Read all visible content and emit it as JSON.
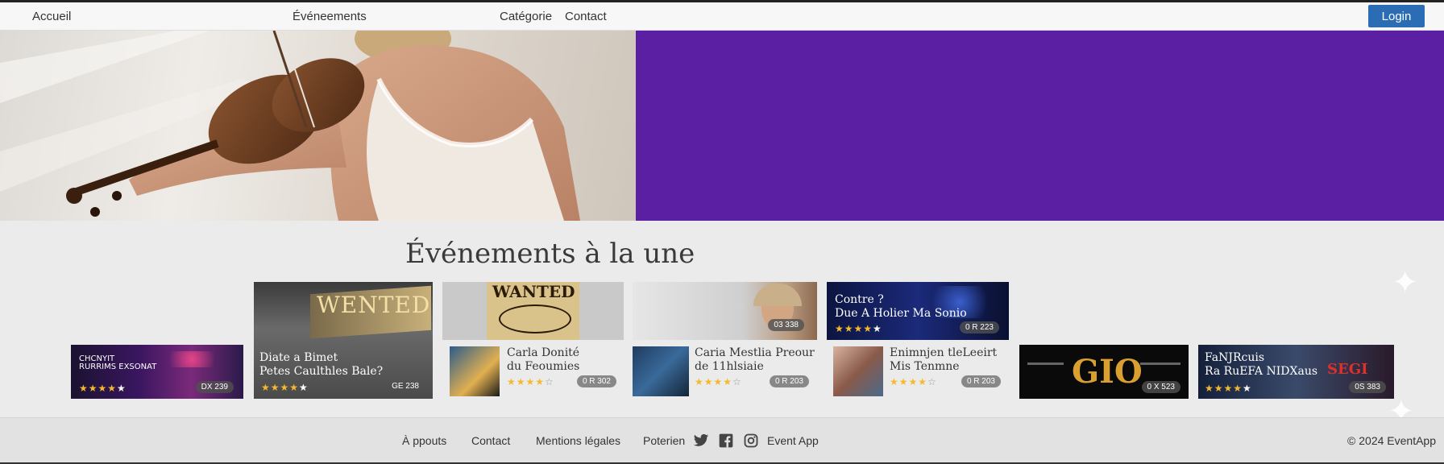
{
  "nav": {
    "home": "Accueil",
    "events": "Événeements",
    "category": "Catégorie",
    "contact": "Contact",
    "login": "Login"
  },
  "colors": {
    "hero_purple": "#5b1fa3",
    "login_blue": "#2a6db5",
    "star": "#f5b82e"
  },
  "section": {
    "title": "Événements à la une"
  },
  "cards": [
    {
      "title1": "CHCNYIT",
      "title2": "RURRIMS EXSONAT",
      "rating": 4,
      "badge": "DX 239"
    },
    {
      "title1": "Diate a Bimet",
      "title2": "Petes Caulthles Bale?",
      "rating": 4,
      "badge": "GE 238",
      "poster": "WENTED"
    },
    {
      "title1": "Carla Donité",
      "title2": "du Feoumies",
      "rating": 4,
      "badge": "0 R 302",
      "poster": "WANTED"
    },
    {
      "title1": "Caria Mestlia Preour",
      "title2": "de 11hlsiaie",
      "rating": 4,
      "badge": "0 R 203",
      "top_badge": "03 338"
    },
    {
      "title1": "Contre ?",
      "title2": "Due A Holier Ma Sonio",
      "rating": 4,
      "badge": "0 R 223"
    },
    {
      "title1": "Enimnjen tleLeeirt",
      "title2": "Mis Tenmne",
      "rating": 4,
      "badge": "0 R 203"
    },
    {
      "title1": "",
      "title2": "",
      "rating": 0,
      "badge": "0 X 523",
      "logo": "GIO"
    },
    {
      "title1": "FaNJRcuis",
      "title2": "Ra RuEFA NIDXaus",
      "rating": 4,
      "badge": "0S 383",
      "logo": "SEGI"
    }
  ],
  "footer": {
    "about": "À ppouts",
    "contact": "Contact",
    "legal": "Mentions légales",
    "partners": "Poterien",
    "brand": "Event App",
    "copyright": "© 2024 EventApp",
    "icons": [
      "twitter-icon",
      "facebook-icon",
      "instagram-icon"
    ]
  }
}
